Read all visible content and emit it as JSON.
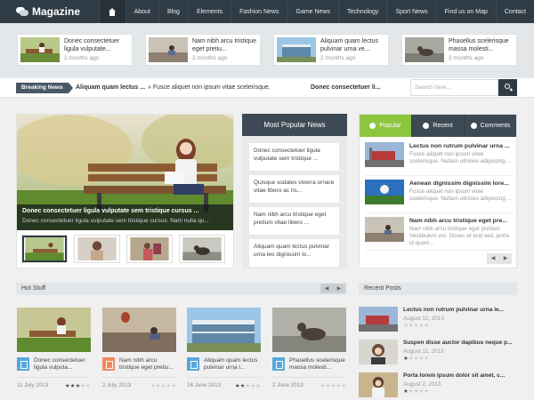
{
  "nav": {
    "logo": "Magazine",
    "items": [
      "About",
      "Blog",
      "Elements",
      "Fashion News",
      "Game News",
      "Technology",
      "Sport News",
      "Find us on Map",
      "Contact"
    ]
  },
  "featured": [
    {
      "title": "Donec consectetuer ligula vulputate...",
      "date": "2 months ago"
    },
    {
      "title": "Nam nibh arcu tristique eget pretiu...",
      "date": "2 months ago"
    },
    {
      "title": "Aliquam quam lectus pulvinar urna ve...",
      "date": "2 months ago"
    },
    {
      "title": "Phasellus scelerisque massa molesti...",
      "date": "3 months ago"
    }
  ],
  "breaking": {
    "label": "Breaking News",
    "items": [
      {
        "text": "Aliquam quam lectus ...",
        "bold": true
      },
      {
        "text": "» Fusce aliquet non ipsum vitae scelerisque.",
        "bold": false
      },
      {
        "text": "Donec consectetuer li...",
        "bold": true
      }
    ]
  },
  "search": {
    "placeholder": "Search here..."
  },
  "slider": {
    "caption_title": "Donec consectetuer ligula vulputate sem tristique cursus ...",
    "caption_text": "Donec consectetuer ligula vulputate sem tristique cursus. Nam nulla qu..."
  },
  "popular": {
    "title": "Most Popular News",
    "items": [
      "Donec consectetuer ligula vulputate sem tristique ...",
      "Quisque sodales viverra ornare vitae libero ac ris...",
      "Nam nibh arcu tristique eget pretium vitae libero ...",
      "Aliquam quam lectus pulvinar urna leo dignissim lo..."
    ]
  },
  "tabs": {
    "labels": [
      "Popular",
      "Recent",
      "Comments"
    ],
    "items": [
      {
        "title": "Lectus non rutrum pulvinar urna ...",
        "text": "Fusce aliquet non ipsum vitae scelerisque. Nullam ultricies adipiscing ..."
      },
      {
        "title": "Aenean dignissim dignissim lore...",
        "text": "Fusce aliquet non ipsum vitae scelerisque. Nullam ultricies adipiscing ..."
      },
      {
        "title": "Nam nibh arcu tristique eget pre...",
        "text": "Nam nibh arcu tristique eget pretium. Vestibulum est. Donec et erat sed, porta id quam..."
      }
    ]
  },
  "hot_stuff": {
    "title": "Hot Stuff",
    "items": [
      {
        "title": "Donec consectetuer ligula vulputa...",
        "date": "11 July 2013",
        "rating": 3
      },
      {
        "title": "Nam nibh arcu tristique eget pretiu...",
        "date": "2 July 2013",
        "rating": 0
      },
      {
        "title": "Aliquam quam lectus pulvinar urna l...",
        "date": "16 June 2013",
        "rating": 2
      },
      {
        "title": "Phasellus scelerisque massa molesti...",
        "date": "2 June 2013",
        "rating": 0
      }
    ]
  },
  "recent_posts": {
    "title": "Recent Posts",
    "items": [
      {
        "title": "Lectus non rutrum pulvinar urna le...",
        "date": "August 12, 2013",
        "rating": 0
      },
      {
        "title": "Suspen disse auctor dapibus neque p...",
        "date": "August 11, 2013",
        "rating": 1
      },
      {
        "title": "Porta lorem ipsum dolor sit amet, c...",
        "date": "August 2, 2013",
        "rating": 1
      }
    ]
  }
}
